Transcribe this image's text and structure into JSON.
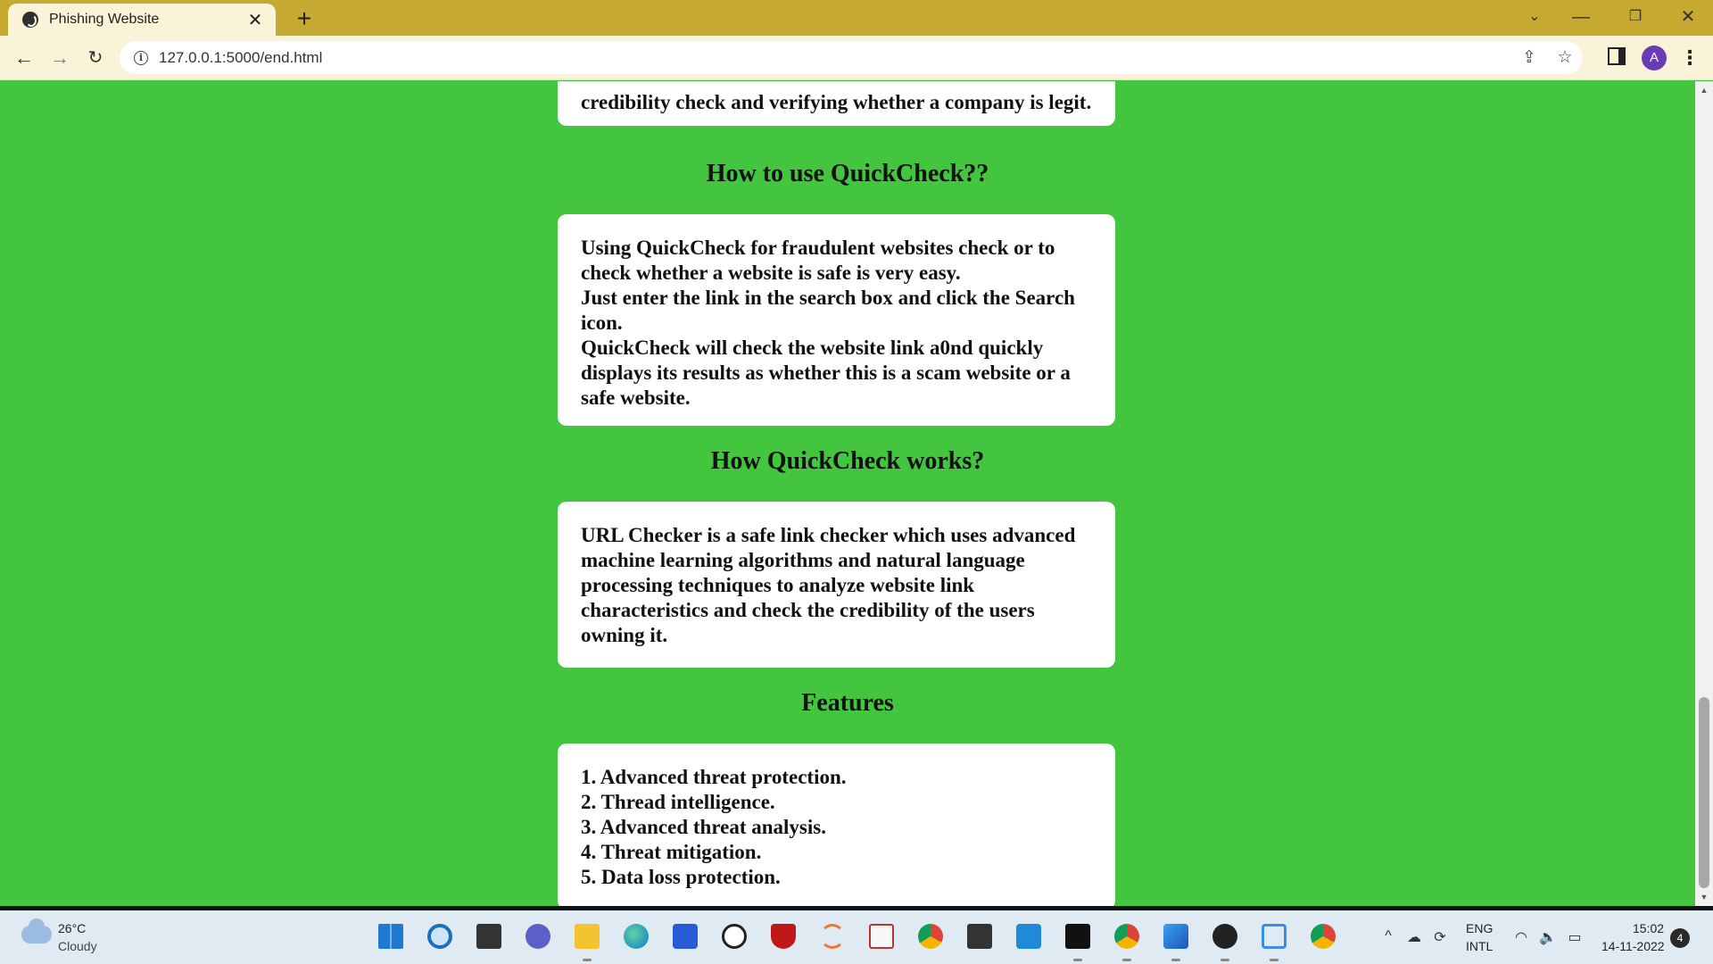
{
  "browser": {
    "tab_title": "Phishing Website",
    "tab_close": "✕",
    "new_tab": "+",
    "url": "127.0.0.1:5000/end.html",
    "profile_initial": "A",
    "controls": {
      "dropdown": "⌄",
      "minimize": "—",
      "restore": "❐",
      "close": "✕"
    },
    "nav": {
      "back": "←",
      "forward": "→",
      "reload": "↻"
    },
    "info_icon": "i",
    "share_icon": "⇪",
    "star_icon": "☆",
    "menu": "⋮"
  },
  "page": {
    "intro_tail": "credibility check and verifying whether a company is legit.",
    "how_to_use": {
      "heading": "How to use QuickCheck??",
      "lines": [
        "Using QuickCheck for fraudulent websites check or to check whether a website is safe is very easy.",
        "Just enter the link in the search box and click the Search icon.",
        "QuickCheck will check the website link a0nd quickly displays its results as whether this is a scam website or a safe website."
      ]
    },
    "how_it_works": {
      "heading": "How QuickCheck works?",
      "text": "URL Checker is a safe link checker which uses advanced machine learning algorithms and natural language processing techniques to analyze website link characteristics and check the credibility of the users owning it."
    },
    "features": {
      "heading": "Features",
      "items": [
        "1. Advanced threat protection.",
        "2. Thread intelligence.",
        "3. Advanced threat analysis.",
        "4. Threat mitigation.",
        "5. Data loss protection."
      ]
    }
  },
  "scrollbar": {
    "up": "▲",
    "down": "▼",
    "position_fraction": 0.95
  },
  "taskbar": {
    "weather_temp": "26°C",
    "weather_desc": "Cloudy",
    "apps": [
      "start-icon",
      "search-icon",
      "task-view-icon",
      "chat-icon",
      "file-explorer-icon",
      "edge-icon",
      "store-icon",
      "dell-icon",
      "mcafee-icon",
      "jupyter-icon",
      "app-icon",
      "chrome-icon",
      "terminal-icon",
      "vscode-icon",
      "cmd-icon",
      "chrome-profile-icon",
      "photos-icon",
      "media-player-icon",
      "screen-icon",
      "chrome-active-icon"
    ],
    "tray_chevron": "^",
    "tray_cloud": "☁",
    "tray_sync": "⟳",
    "lang_line1": "ENG",
    "lang_line2": "INTL",
    "wifi_icon": "◠",
    "volume_icon": "🔈",
    "battery_icon": "▭",
    "time": "15:02",
    "date": "14-11-2022",
    "notifications": "4",
    "colors": {
      "accent": "#1a73c8",
      "page_bg": "#44c540",
      "tab_bar": "#c5a930"
    }
  }
}
